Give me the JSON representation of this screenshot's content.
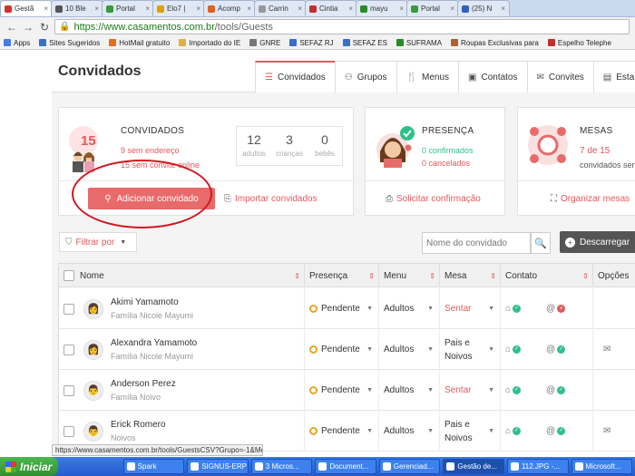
{
  "browser": {
    "tabs": [
      {
        "label": "Gestã",
        "color": "#d9302c",
        "active": true
      },
      {
        "label": "10 Ble",
        "color": "#555"
      },
      {
        "label": "Portal",
        "color": "#3a9b3a"
      },
      {
        "label": "Elo7 |",
        "color": "#e0a000"
      },
      {
        "label": "Acomp",
        "color": "#e06020"
      },
      {
        "label": "Carrin",
        "color": "#999"
      },
      {
        "label": "Cintia",
        "color": "#c03030"
      },
      {
        "label": "mayu",
        "color": "#2a8a2a"
      },
      {
        "label": "Portal",
        "color": "#3a9b3a"
      },
      {
        "label": "(25) N",
        "color": "#3060c0"
      }
    ],
    "url_host": "https://www.casamentos.com.br",
    "url_path": "/tools/Guests",
    "bookmarks": [
      {
        "label": "Apps",
        "color": "#4a7de0"
      },
      {
        "label": "Sites Sugeridos",
        "color": "#3a6fc8"
      },
      {
        "label": "HotMail gratuito",
        "color": "#e07020"
      },
      {
        "label": "Importado do IE",
        "color": "#e0b040"
      },
      {
        "label": "GNRE",
        "color": "#777"
      },
      {
        "label": "SEFAZ RJ",
        "color": "#3a6fc8"
      },
      {
        "label": "SEFAZ ES",
        "color": "#3a6fc8"
      },
      {
        "label": "SUFRAMA",
        "color": "#2a8a2a"
      },
      {
        "label": "Roupas Exclusivas para",
        "color": "#b06030"
      },
      {
        "label": "Espelho Telephe",
        "color": "#c03030"
      }
    ],
    "status_url": "https://www.casamentos.com.br/tools/GuestsCSV?Grupo=-1&Men..."
  },
  "page": {
    "title": "Convidados",
    "tabs": [
      {
        "label": "Convidados",
        "icon": "list-icon",
        "glyph": "☰"
      },
      {
        "label": "Grupos",
        "icon": "group-icon",
        "glyph": "⚇"
      },
      {
        "label": "Menus",
        "icon": "cutlery-icon",
        "glyph": "🍴"
      },
      {
        "label": "Contatos",
        "icon": "address-book-icon",
        "glyph": "▣"
      },
      {
        "label": "Convites",
        "icon": "envelope-icon",
        "glyph": "✉"
      },
      {
        "label": "Esta",
        "icon": "stats-icon",
        "glyph": "▤"
      }
    ]
  },
  "guests_card": {
    "count": "15",
    "title": "CONVIDADOS",
    "no_address": "9 sem endereço",
    "no_invite": "15 sem convite online",
    "stats": [
      {
        "n": "12",
        "label": "adultos"
      },
      {
        "n": "3",
        "label": "crianças"
      },
      {
        "n": "0",
        "label": "bebês"
      }
    ],
    "add_label": "Adicionar convidado",
    "import_label": "Importar convidados"
  },
  "presence_card": {
    "title": "PRESENÇA",
    "confirmed": "0 confirmados",
    "cancelled": "0 cancelados",
    "action": "Solicitar confirmação"
  },
  "tables_card": {
    "title": "MESAS",
    "count": "7 de 15",
    "sub": "convidados sen",
    "action": "Organizar mesas"
  },
  "filters": {
    "filter_label": "Filtrar por",
    "search_placeholder": "Nome do convidado",
    "download_label": "Descarregar"
  },
  "table": {
    "headers": [
      "Nome",
      "Presença",
      "Menu",
      "Mesa",
      "Contato",
      "Opções"
    ],
    "rows": [
      {
        "name": "Akimi Yamamoto",
        "family": "Família Nicole Mayumi",
        "presence": "Pendente",
        "menu": "Adultos",
        "table": "Sentar",
        "table_red": true,
        "avatar": "female"
      },
      {
        "name": "Alexandra Yamamoto",
        "family": "Família Nicole Mayumi",
        "presence": "Pendente",
        "menu": "Adultos",
        "table": "Pais e Noivos",
        "table_red": false,
        "avatar": "female"
      },
      {
        "name": "Anderson Perez",
        "family": "Família Noivo",
        "presence": "Pendente",
        "menu": "Adultos",
        "table": "Sentar",
        "table_red": true,
        "avatar": "male"
      },
      {
        "name": "Erick Romero",
        "family": "Noivos",
        "presence": "Pendente",
        "menu": "Adultos",
        "table": "Pais e Noivos",
        "table_red": false,
        "avatar": "male"
      }
    ]
  },
  "taskbar": {
    "start": "Iniciar",
    "items": [
      "Spark",
      "SIGNUS-ERP",
      "3 Micros...",
      "Document...",
      "Gerenciad...",
      "Gestão de...",
      "112.JPG -...",
      "Microsoft..."
    ]
  },
  "colors": {
    "accent": "#e05a5a",
    "green": "#2fbf8b"
  }
}
